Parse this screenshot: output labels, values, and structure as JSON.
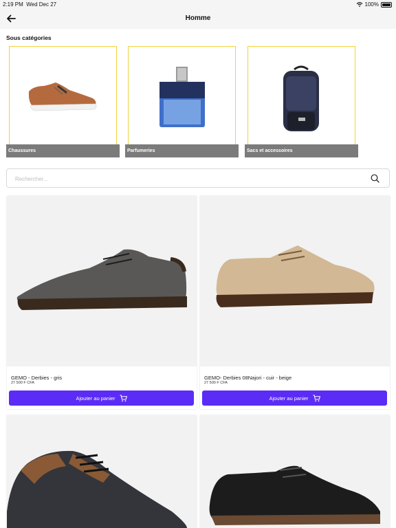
{
  "status": {
    "time": "2:19 PM",
    "date": "Wed Dec 27",
    "battery": "100%"
  },
  "header": {
    "title": "Homme"
  },
  "categories": {
    "title": "Sous catégories",
    "items": [
      {
        "label": "Chaussures"
      },
      {
        "label": "Parfumeries"
      },
      {
        "label": "Sacs et accessoires"
      }
    ]
  },
  "search": {
    "placeholder": "Rechercher..."
  },
  "products": [
    {
      "name": "GEMO - Derbies - gris",
      "price": "27 500 F CFA",
      "button": "Ajouter au panier"
    },
    {
      "name": "GEMO- Derbies 08Najori - cuir - beige",
      "price": "27 500 F CFA",
      "button": "Ajouter au panier"
    },
    {
      "name": "",
      "price": "",
      "button": ""
    },
    {
      "name": "",
      "price": "",
      "button": ""
    }
  ],
  "colors": {
    "accent": "#5b2cf6",
    "category_border": "#f2d23c",
    "category_label_bg": "#7b7b7b"
  }
}
